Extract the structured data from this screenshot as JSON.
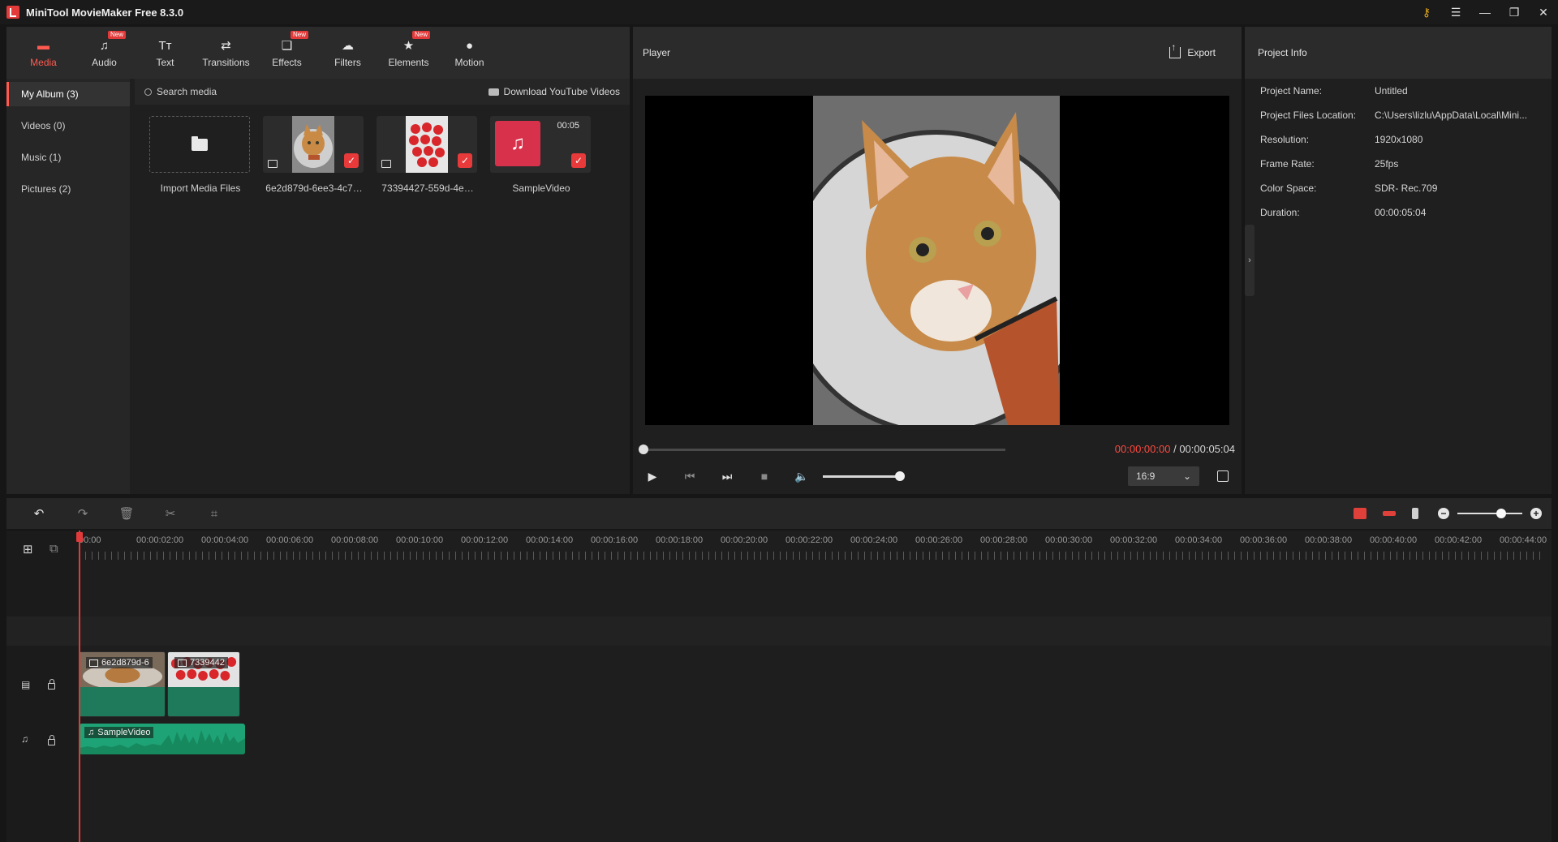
{
  "app": {
    "title": "MiniTool MovieMaker Free 8.3.0"
  },
  "window_controls": [
    "key-icon",
    "menu-icon",
    "minimize-icon",
    "maximize-icon",
    "close-icon"
  ],
  "tabs": [
    {
      "label": "Media",
      "icon": "media-icon",
      "active": true,
      "new": false
    },
    {
      "label": "Audio",
      "icon": "music-icon",
      "active": false,
      "new": true
    },
    {
      "label": "Text",
      "icon": "text-icon",
      "active": false,
      "new": false
    },
    {
      "label": "Transitions",
      "icon": "transitions-icon",
      "active": false,
      "new": false
    },
    {
      "label": "Effects",
      "icon": "effects-icon",
      "active": false,
      "new": true
    },
    {
      "label": "Filters",
      "icon": "filters-icon",
      "active": false,
      "new": false
    },
    {
      "label": "Elements",
      "icon": "elements-icon",
      "active": false,
      "new": true
    },
    {
      "label": "Motion",
      "icon": "motion-icon",
      "active": false,
      "new": false
    }
  ],
  "badge_new": "New",
  "albums": [
    {
      "label": "My Album (3)",
      "active": true
    },
    {
      "label": "Videos (0)",
      "active": false
    },
    {
      "label": "Music (1)",
      "active": false
    },
    {
      "label": "Pictures (2)",
      "active": false
    }
  ],
  "media": {
    "search_placeholder": "Search media",
    "download_label": "Download YouTube Videos",
    "import_label": "Import Media Files",
    "items": [
      {
        "label": "6e2d879d-6ee3-4c7…",
        "kind": "image"
      },
      {
        "label": "73394427-559d-4e…",
        "kind": "image"
      },
      {
        "label": "SampleVideo",
        "kind": "audio",
        "duration": "00:05"
      }
    ]
  },
  "player": {
    "title": "Player",
    "export_label": "Export",
    "current_time": "00:00:00:00",
    "separator": " / ",
    "total_time": "00:00:05:04",
    "aspect_ratio": "16:9",
    "volume": 1.0,
    "progress": 0.0
  },
  "project_info": {
    "title": "Project Info",
    "rows": [
      {
        "label": "Project Name:",
        "value": "Untitled"
      },
      {
        "label": "Project Files Location:",
        "value": "C:\\Users\\lizlu\\AppData\\Local\\Mini..."
      },
      {
        "label": "Resolution:",
        "value": "1920x1080"
      },
      {
        "label": "Frame Rate:",
        "value": "25fps"
      },
      {
        "label": "Color Space:",
        "value": "SDR- Rec.709"
      },
      {
        "label": "Duration:",
        "value": "00:00:05:04"
      }
    ]
  },
  "timeline": {
    "ruler": [
      "00:00",
      "00:00:02:00",
      "00:00:04:00",
      "00:00:06:00",
      "00:00:08:00",
      "00:00:10:00",
      "00:00:12:00",
      "00:00:14:00",
      "00:00:16:00",
      "00:00:18:00",
      "00:00:20:00",
      "00:00:22:00",
      "00:00:24:00",
      "00:00:26:00",
      "00:00:28:00",
      "00:00:30:00",
      "00:00:32:00",
      "00:00:34:00",
      "00:00:36:00",
      "00:00:38:00",
      "00:00:40:00",
      "00:00:42:00",
      "00:00:44:00"
    ],
    "video_clips": [
      {
        "label": "6e2d879d-6"
      },
      {
        "label": "7339442"
      }
    ],
    "audio_clips": [
      {
        "label": "SampleVideo"
      }
    ],
    "zoom_level": 0.6
  },
  "colors": {
    "accent": "#ff5a50",
    "playhead": "#e23a3a",
    "video_clip": "#1e7a5a",
    "audio_clip": "#1ea376",
    "music_tile": "#d8314b"
  }
}
